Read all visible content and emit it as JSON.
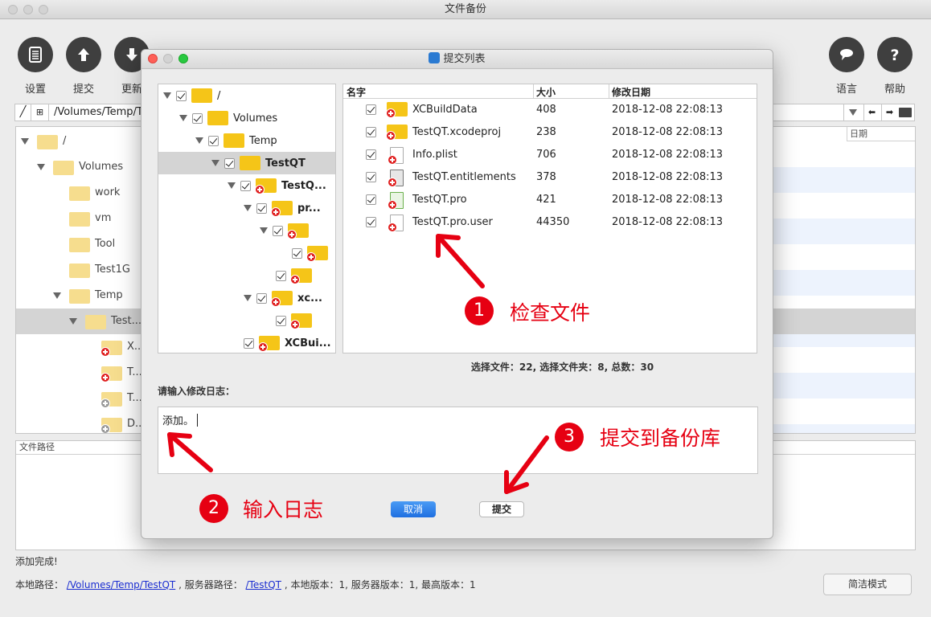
{
  "window": {
    "title": "文件备份"
  },
  "toolbar": {
    "buttons": [
      {
        "label": "设置",
        "icon": "settings-icon"
      },
      {
        "label": "提交",
        "icon": "upload-icon"
      },
      {
        "label": "更新",
        "icon": "download-icon"
      },
      {
        "label": "语言",
        "icon": "language-icon"
      },
      {
        "label": "帮助",
        "icon": "help-icon"
      }
    ]
  },
  "pathbar": {
    "path": "/Volumes/Temp/Te"
  },
  "bg_tree": {
    "col_date": "日期",
    "items": [
      {
        "label": "/",
        "depth": 0
      },
      {
        "label": "Volumes",
        "depth": 1
      },
      {
        "label": "work",
        "depth": 2
      },
      {
        "label": "vm",
        "depth": 2
      },
      {
        "label": "Tool",
        "depth": 2
      },
      {
        "label": "Test1G",
        "depth": 2
      },
      {
        "label": "Temp",
        "depth": 2
      },
      {
        "label": "Test...",
        "depth": 3
      },
      {
        "label": "X...",
        "depth": 4
      },
      {
        "label": "T...",
        "depth": 4
      },
      {
        "label": "T...",
        "depth": 4
      },
      {
        "label": "D...",
        "depth": 4
      }
    ]
  },
  "filepath_panel": {
    "header": "文件路径"
  },
  "status": {
    "message": "添加完成!"
  },
  "info": {
    "local_label": "本地路径：",
    "local_path": "/Volumes/Temp/TestQT",
    "server_label": ", 服务器路径：",
    "server_path": "/TestQT",
    "versions": ", 本地版本：1, 服务器版本：1, 最高版本：1"
  },
  "simple_mode": {
    "label": "简洁模式"
  },
  "dialog": {
    "title": "提交列表",
    "tree": [
      {
        "label": "/"
      },
      {
        "label": "Volumes"
      },
      {
        "label": "Temp"
      },
      {
        "label": "TestQT"
      },
      {
        "label": "TestQ..."
      },
      {
        "label": "pr..."
      },
      {
        "label": ""
      },
      {
        "label": ""
      },
      {
        "label": ""
      },
      {
        "label": "xc..."
      },
      {
        "label": ""
      },
      {
        "label": "XCBui..."
      }
    ],
    "list_headers": {
      "name": "名字",
      "size": "大小",
      "date": "修改日期"
    },
    "files": [
      {
        "name": "XCBuildData",
        "size": "408",
        "date": "2018-12-08 22:08:13",
        "kind": "folder"
      },
      {
        "name": "TestQT.xcodeproj",
        "size": "238",
        "date": "2018-12-08 22:08:13",
        "kind": "folder"
      },
      {
        "name": "Info.plist",
        "size": "706",
        "date": "2018-12-08 22:08:13",
        "kind": "doc"
      },
      {
        "name": "TestQT.entitlements",
        "size": "378",
        "date": "2018-12-08 22:08:13",
        "kind": "doc"
      },
      {
        "name": "TestQT.pro",
        "size": "421",
        "date": "2018-12-08 22:08:13",
        "kind": "doc"
      },
      {
        "name": "TestQT.pro.user",
        "size": "44350",
        "date": "2018-12-08 22:08:13",
        "kind": "doc"
      }
    ],
    "summary": "选择文件：22,  选择文件夹：8,  总数：30",
    "log_label": "请输入修改日志：",
    "log_value": "添加。",
    "cancel_label": "取消",
    "submit_label": "提交"
  },
  "annotations": [
    {
      "num": "1",
      "text": "检查文件"
    },
    {
      "num": "2",
      "text": "输入日志"
    },
    {
      "num": "3",
      "text": "提交到备份库"
    }
  ],
  "colors": {
    "accent": "#e60012",
    "button_blue": "#1f6fe0",
    "folder": "#f5c518"
  }
}
